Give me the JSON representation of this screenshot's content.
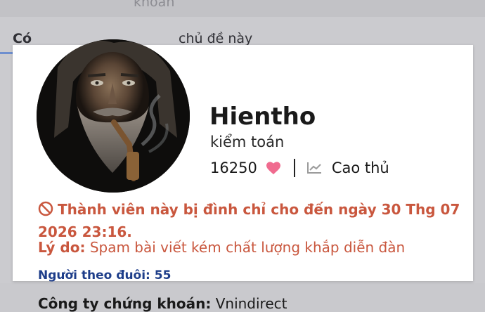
{
  "background": {
    "top_text": "khoản",
    "tab_prefix": "Có",
    "topic_text": "chủ đề này"
  },
  "profile": {
    "username": "Hientho",
    "title": "kiểm toán",
    "likes": "16250",
    "rank": "Cao thủ",
    "heart_color": "#f06b8f",
    "ban_message": "Thành viên này bị đình chỉ cho đến ngày 30 Thg 07 2026 23:16.",
    "ban_color": "#c9573e",
    "reason_label": "Lý do:",
    "reason_text": "Spam bài viết kém chất lượng khắp diễn đàn",
    "followers_text": "Người theo đuôi: 55",
    "followers_color": "#1e3e8a",
    "company_label": "Công ty chứng khoán:",
    "company_value": "Vnindirect"
  },
  "icons": {
    "heart": "heart-icon",
    "chart": "chart-line-icon",
    "ban": "ban-icon"
  }
}
